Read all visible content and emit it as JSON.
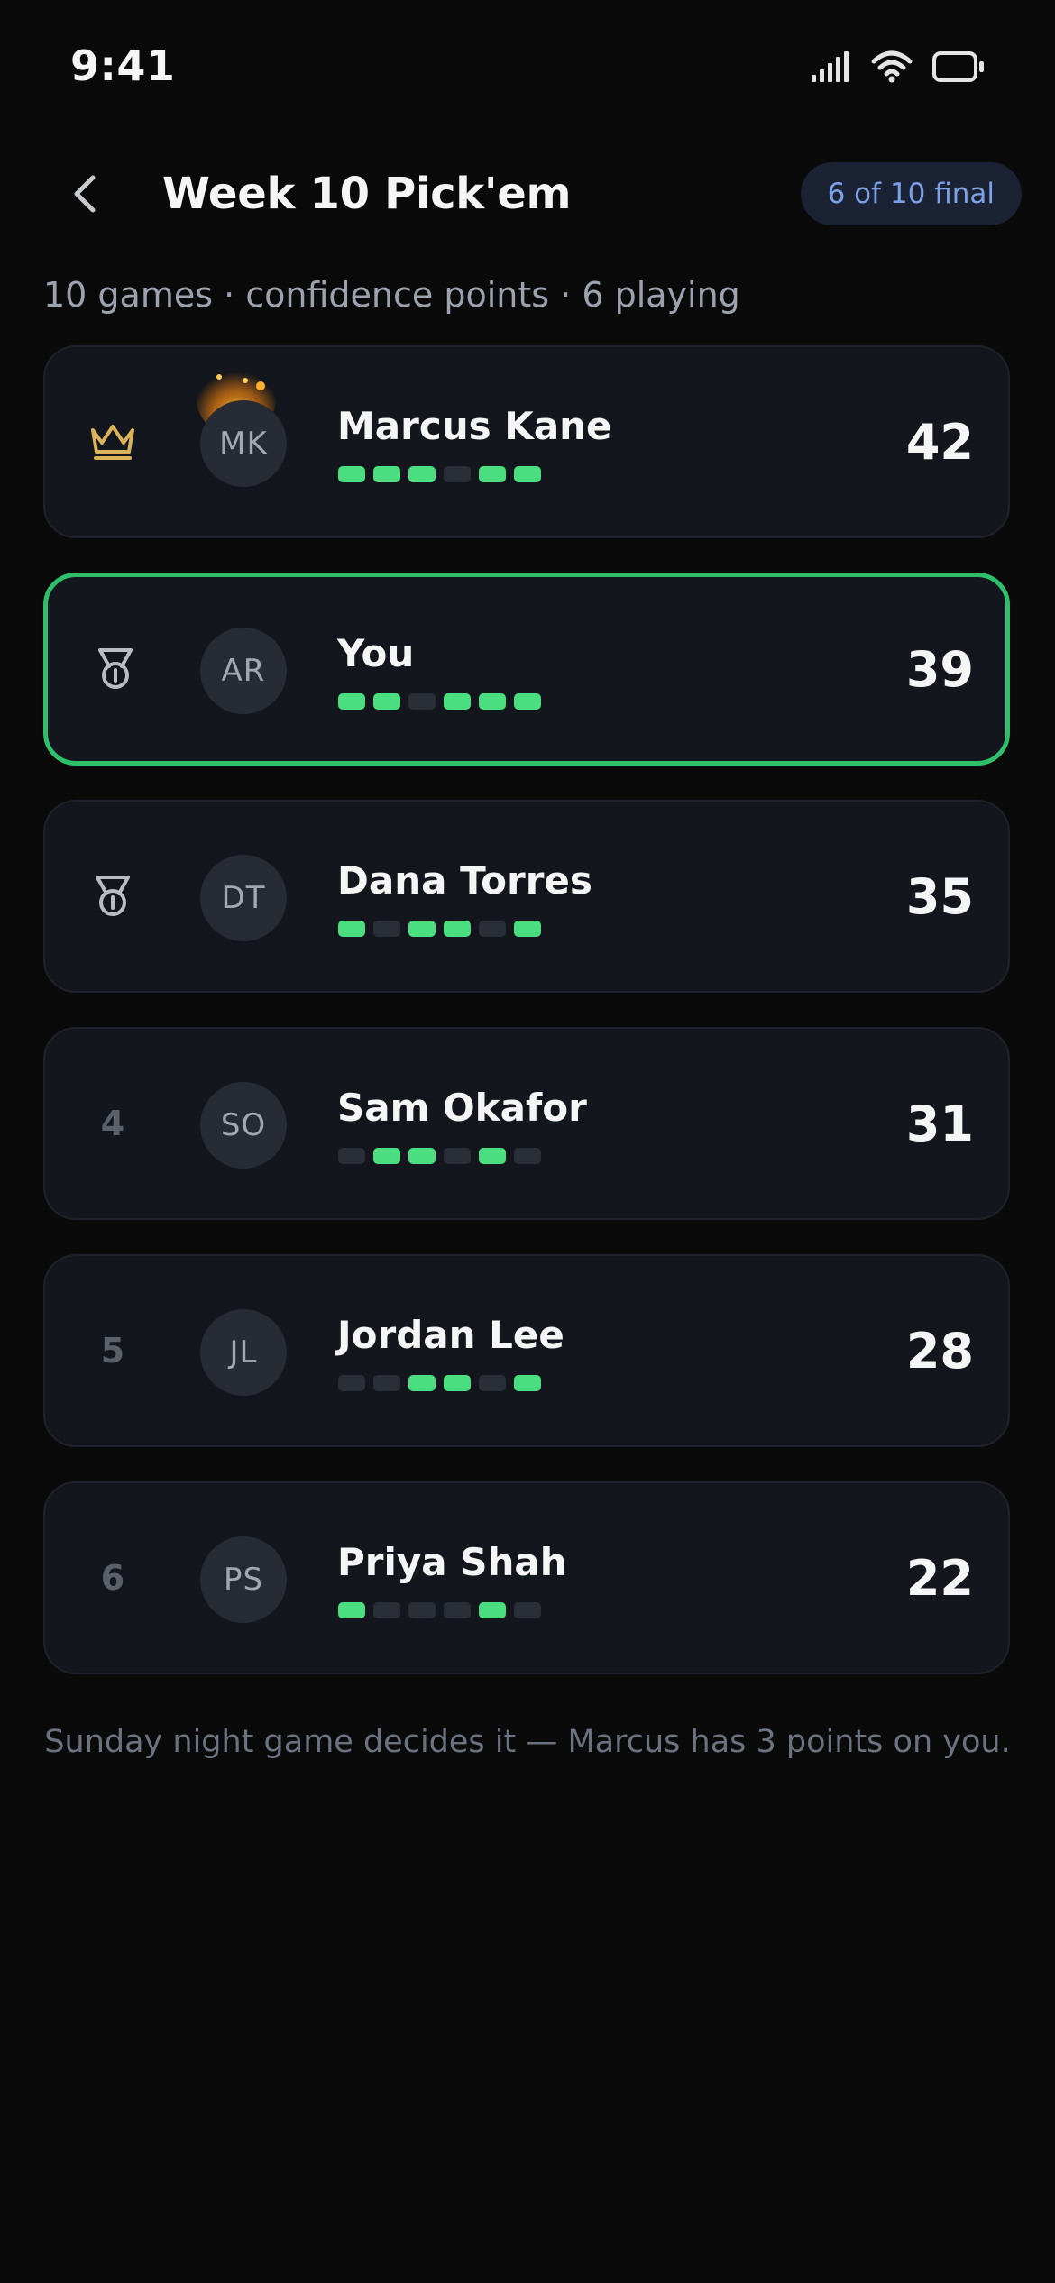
{
  "status_bar": {
    "time": "9:41"
  },
  "header": {
    "title": "Week 10 Pick'em",
    "status_pill": "6 of 10 final",
    "back_icon": "chevron-left-icon"
  },
  "subtitle": "10 games · confidence points · 6 playing",
  "colors": {
    "accent_green": "#4ade80",
    "highlight_border": "#2fbf6a",
    "pill_text": "#7ea0e6",
    "crown_gold": "#d9b25a"
  },
  "entries": [
    {
      "rank_icon": "crown-icon",
      "rank": "",
      "initials": "MK",
      "name": "Marcus Kane",
      "score": "42",
      "picks": [
        1,
        1,
        1,
        0,
        1,
        1
      ]
    },
    {
      "rank_icon": "medal-icon",
      "rank": "",
      "initials": "AR",
      "name": "You",
      "score": "39",
      "picks": [
        1,
        1,
        0,
        1,
        1,
        1
      ]
    },
    {
      "rank_icon": "medal-icon",
      "rank": "",
      "initials": "DT",
      "name": "Dana Torres",
      "score": "35",
      "picks": [
        1,
        0,
        1,
        1,
        0,
        1
      ]
    },
    {
      "rank_icon": "",
      "rank": "4",
      "initials": "SO",
      "name": "Sam Okafor",
      "score": "31",
      "picks": [
        0,
        1,
        1,
        0,
        1,
        0
      ]
    },
    {
      "rank_icon": "",
      "rank": "5",
      "initials": "JL",
      "name": "Jordan Lee",
      "score": "28",
      "picks": [
        0,
        0,
        1,
        1,
        0,
        1
      ]
    },
    {
      "rank_icon": "",
      "rank": "6",
      "initials": "PS",
      "name": "Priya Shah",
      "score": "22",
      "picks": [
        1,
        0,
        0,
        0,
        1,
        0
      ]
    }
  ],
  "footer_note": "Sunday night game decides it — Marcus has 3 points on you."
}
